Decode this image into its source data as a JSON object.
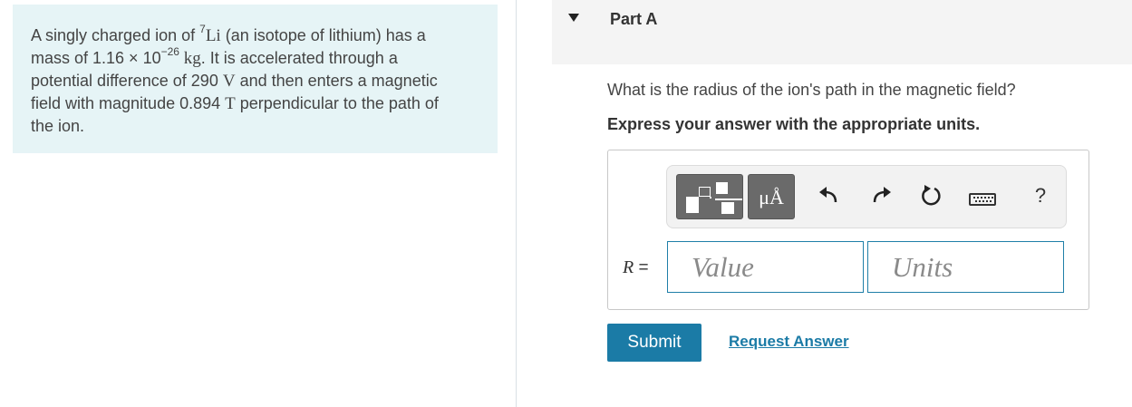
{
  "problem": {
    "t1": "A singly charged ion of ",
    "iso_sup": "7",
    "iso_el": "Li",
    "t2": " (an isotope of lithium) has a",
    "t3": "mass of 1.16 × 10",
    "exp": "−26",
    "unit_kg": " kg",
    "t4": ". It is accelerated through a",
    "t5": "potential difference of 290 ",
    "unit_v": "V",
    "t6": " and then enters a magnetic",
    "t7": "field with magnitude 0.894 ",
    "unit_t": "T",
    "t8": " perpendicular to the path of",
    "t9": "the ion."
  },
  "part": {
    "title": "Part A",
    "question": "What is the radius of the ion's path in the magnetic field?",
    "instruction": "Express your answer with the appropriate units."
  },
  "toolbar": {
    "units_label": "μÅ",
    "help_label": "?",
    "icons": [
      "templates-icon",
      "units-icon",
      "undo-icon",
      "redo-icon",
      "reset-icon",
      "keyboard-icon",
      "help-icon"
    ]
  },
  "answer": {
    "variable": "R",
    "equals": " =",
    "value_placeholder": "Value",
    "units_placeholder": "Units"
  },
  "actions": {
    "submit": "Submit",
    "request": "Request Answer"
  },
  "colors": {
    "accent": "#1b7ba6",
    "panel_bg": "#e6f4f6"
  }
}
